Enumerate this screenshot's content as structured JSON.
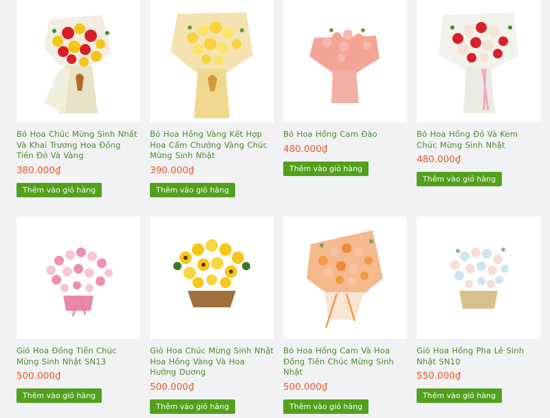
{
  "products": [
    {
      "title": "Bó Hoa Chúc Mừng Sinh Nhất Và Khai Trương Hoa Đồng Tiền Đỏ Và Vàng",
      "price": "380.000₫",
      "button": "Thêm vào giỏ hàng"
    },
    {
      "title": "Bó Hoa Hồng Vàng Kết Hợp Hoa Cẩm Chướng Vàng Chúc Mừng Sinh Nhật",
      "price": "390.000₫",
      "button": "Thêm vào giỏ hàng"
    },
    {
      "title": "Bó Hoa Hồng Cam Đào",
      "price": "480.000₫",
      "button": "Thêm vào giỏ hàng"
    },
    {
      "title": "Bó Hoa Hồng Đỏ Và Kem Chúc Mừng Sinh Nhật",
      "price": "480.000₫",
      "button": "Thêm vào giỏ hàng"
    },
    {
      "title": "Giỏ Hoa Đồng Tiền Chúc Mừng Sinh Nhật SN13",
      "price": "500.000₫",
      "button": "Thêm vào giỏ hàng"
    },
    {
      "title": "Giỏ Hoa Chúc Mừng Sinh Nhật Hoa Hồng Vàng Và Hoa Hướng Dương",
      "price": "500.000₫",
      "button": "Thêm vào giỏ hàng"
    },
    {
      "title": "Bó Hoa Hồng Cam Và Hoa Đồng Tiền Chúc Mừng Sinh Nhật",
      "price": "500.000₫",
      "button": "Thêm vào giỏ hàng"
    },
    {
      "title": "Giỏ Hoa Hồng Pha Lê Sinh Nhật SN10",
      "price": "550.000₫",
      "button": "Thêm vào giỏ hàng"
    }
  ],
  "colors": {
    "title": "#4a8a2a",
    "price": "#e8562a",
    "button_bg": "#52a01c",
    "background": "#f1f2f4"
  }
}
